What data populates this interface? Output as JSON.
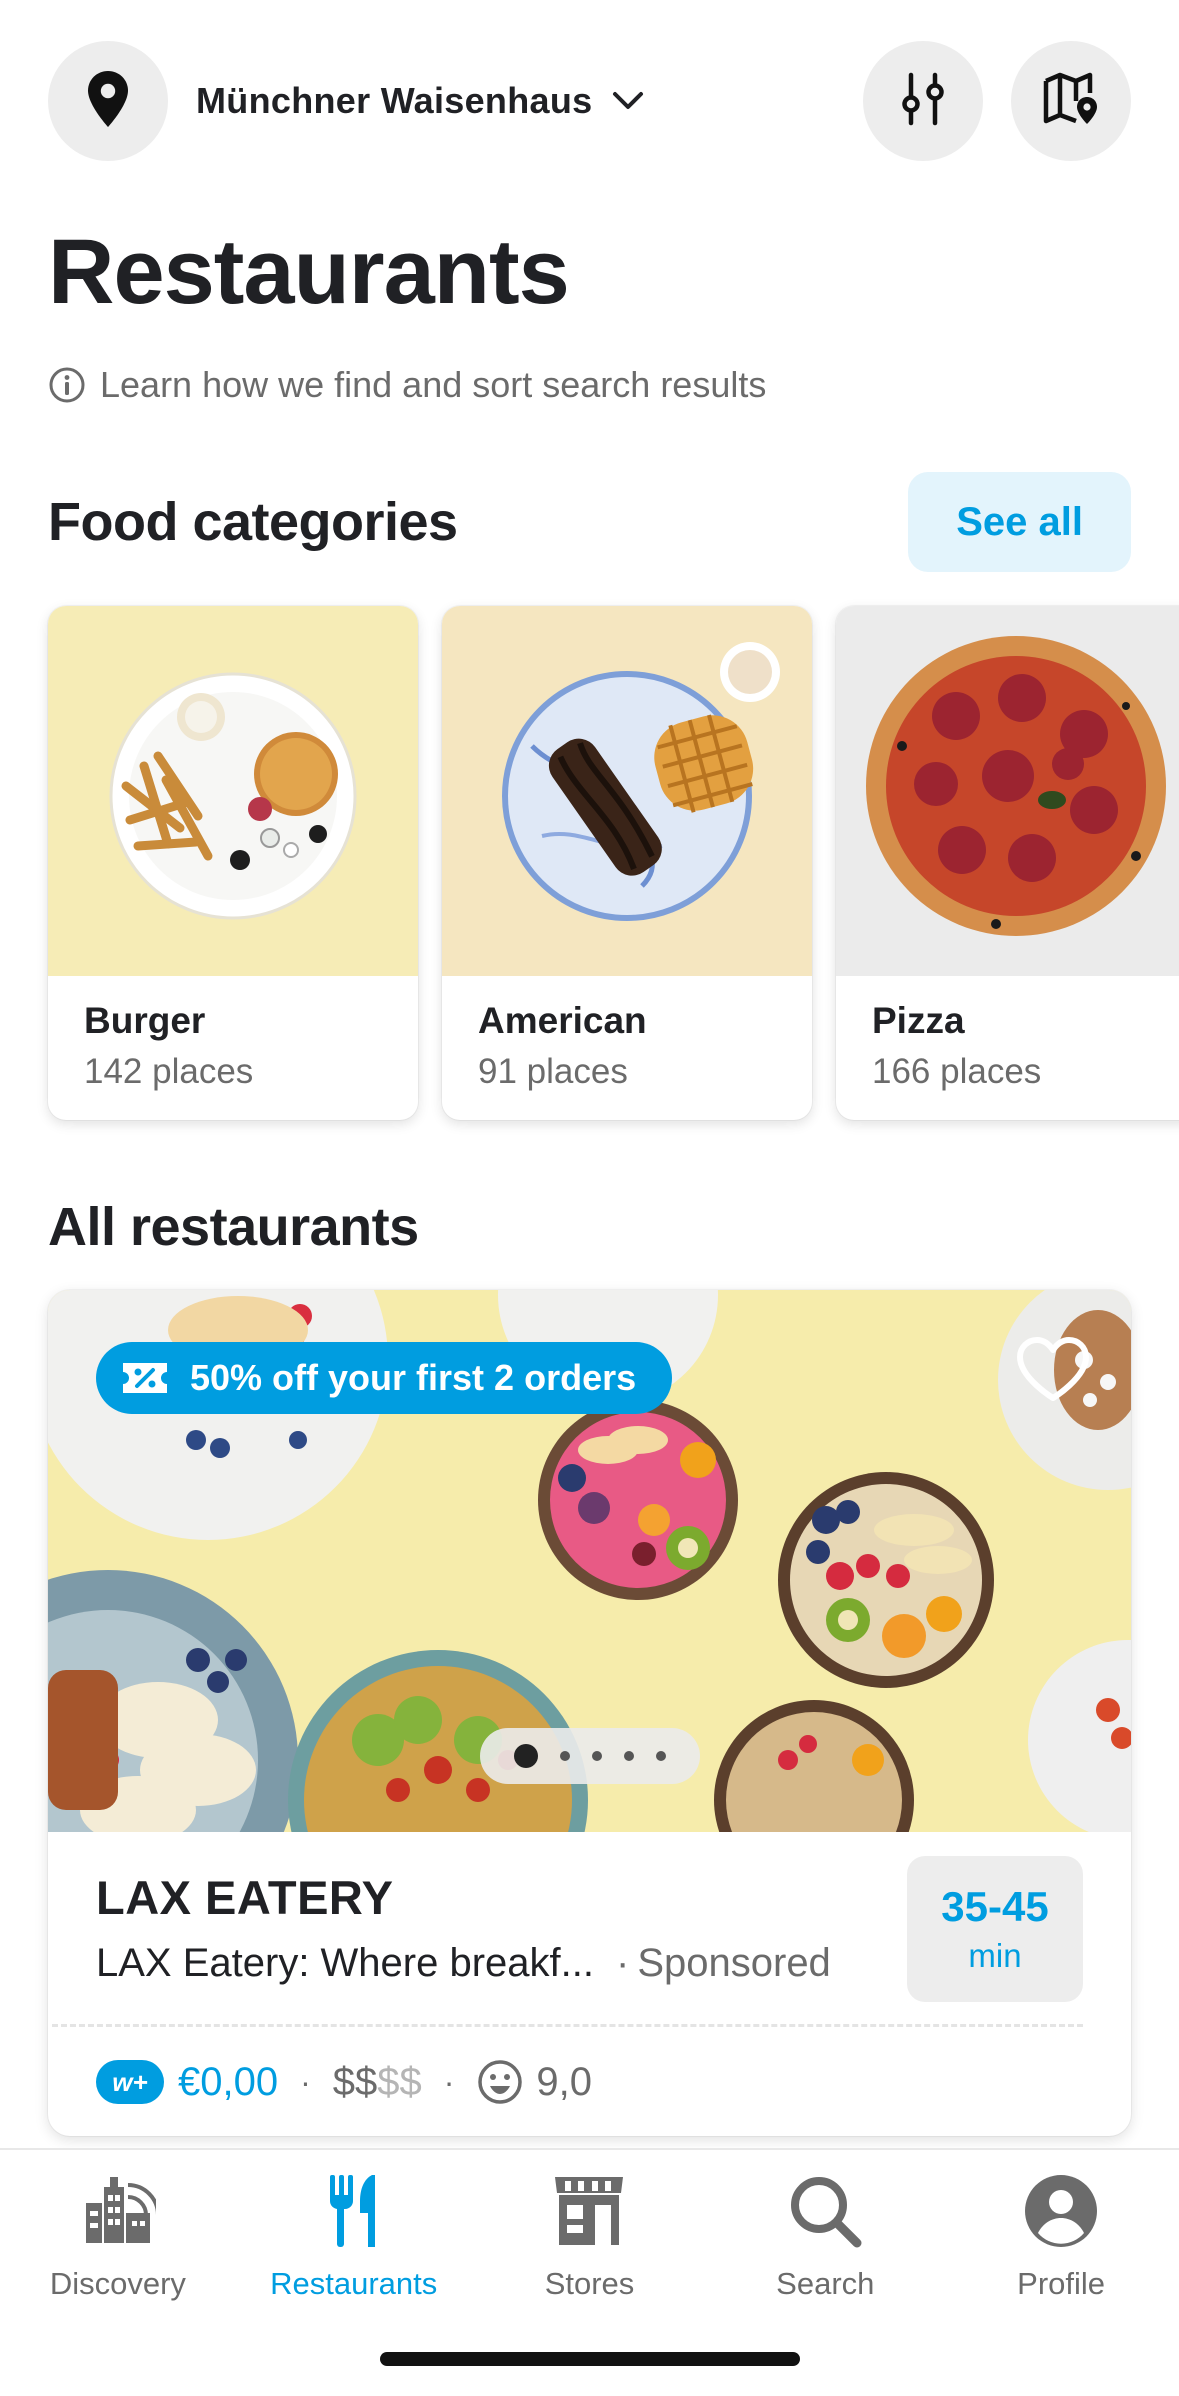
{
  "header": {
    "location": "Münchner Waisenhaus",
    "location_icon": "map-pin-icon",
    "filter_icon": "filter-sliders-icon",
    "map_icon": "map-icon"
  },
  "page_title": "Restaurants",
  "learn_link": "Learn how we find and sort search results",
  "categories_section": {
    "title": "Food categories",
    "see_all": "See all",
    "items": [
      {
        "name": "Burger",
        "count": "142 places"
      },
      {
        "name": "American",
        "count": "91 places"
      },
      {
        "name": "Pizza",
        "count": "166 places"
      }
    ]
  },
  "restaurants_section": {
    "title": "All restaurants",
    "card": {
      "promo": "50% off your first 2 orders",
      "name": "LAX EATERY",
      "description": "LAX Eatery: Where breakf...",
      "separator": "·",
      "sponsored": "Sponsored",
      "eta_time": "35-45",
      "eta_unit": "min",
      "wplus": "w+",
      "delivery_fee": "€0,00",
      "price_active": "$$",
      "price_inactive": "$$",
      "rating": "9,0"
    }
  },
  "nav": [
    {
      "label": "Discovery",
      "icon": "discovery-icon"
    },
    {
      "label": "Restaurants",
      "icon": "fork-knife-icon",
      "active": true
    },
    {
      "label": "Stores",
      "icon": "store-icon"
    },
    {
      "label": "Search",
      "icon": "search-icon"
    },
    {
      "label": "Profile",
      "icon": "profile-icon"
    }
  ],
  "colors": {
    "accent": "#009de0",
    "text": "#202125",
    "muted": "#6b6b6b",
    "chip_bg": "#ededed",
    "see_all_bg": "#e3f4fc"
  }
}
